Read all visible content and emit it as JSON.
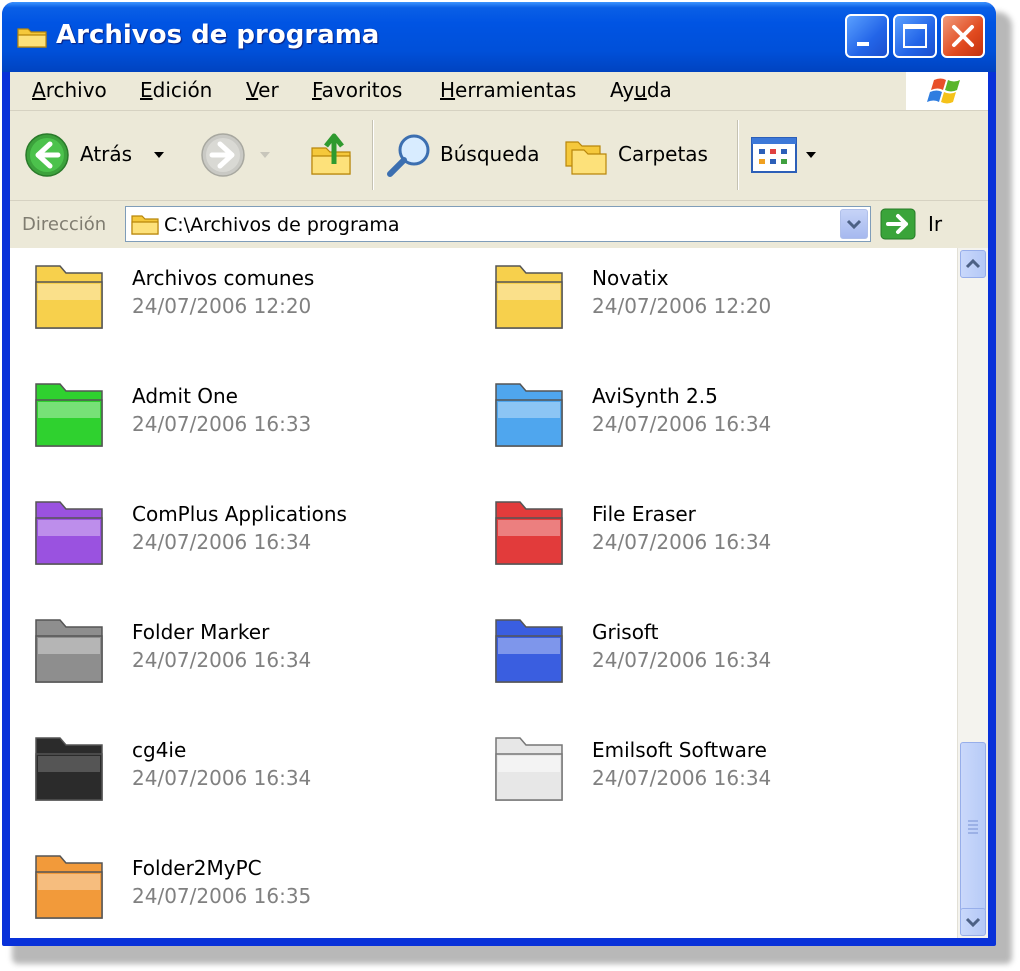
{
  "window": {
    "title": "Archivos de programa",
    "title_icon": "folder-icon",
    "controls": [
      "minimize-icon",
      "maximize-icon",
      "close-icon"
    ]
  },
  "menubar": {
    "items": [
      {
        "label": "Archivo",
        "underline": "A"
      },
      {
        "label": "Edición",
        "underline": "E"
      },
      {
        "label": "Ver",
        "underline": "V"
      },
      {
        "label": "Favoritos",
        "underline": "F"
      },
      {
        "label": "Herramientas",
        "underline": "H"
      },
      {
        "label": "Ayuda",
        "underline": "u"
      }
    ]
  },
  "toolbar": {
    "back_label": "Atrás",
    "search_label": "Búsqueda",
    "folders_label": "Carpetas",
    "icons": [
      "back-arrow-icon",
      "forward-arrow-icon",
      "up-folder-icon",
      "search-magnifier-icon",
      "folders-icon",
      "views-icon"
    ]
  },
  "address": {
    "label": "Dirección",
    "value": "C:\\Archivos de programa",
    "go_label": "Ir"
  },
  "items": [
    {
      "name": "Archivos comunes",
      "date": "24/07/2006 12:20",
      "color": "#f7d04c"
    },
    {
      "name": "Novatix",
      "date": "24/07/2006 12:20",
      "color": "#f7d04c"
    },
    {
      "name": "Admit One",
      "date": "24/07/2006 16:33",
      "color": "#2fd12f"
    },
    {
      "name": "AviSynth 2.5",
      "date": "24/07/2006 16:34",
      "color": "#4fa6ee"
    },
    {
      "name": "ComPlus Applications",
      "date": "24/07/2006 16:34",
      "color": "#9a52e0"
    },
    {
      "name": "File Eraser",
      "date": "24/07/2006 16:34",
      "color": "#e23b3b"
    },
    {
      "name": "Folder Marker",
      "date": "24/07/2006 16:34",
      "color": "#8e8e8e"
    },
    {
      "name": "Grisoft",
      "date": "24/07/2006 16:34",
      "color": "#3a5ee0"
    },
    {
      "name": "cg4ie",
      "date": "24/07/2006 16:34",
      "color": "#2b2b2b"
    },
    {
      "name": "Emilsoft Software",
      "date": "24/07/2006 16:34",
      "color": "#e7e7e7"
    },
    {
      "name": "Folder2MyPC",
      "date": "24/07/2006 16:35",
      "color": "#f29a3a"
    }
  ]
}
